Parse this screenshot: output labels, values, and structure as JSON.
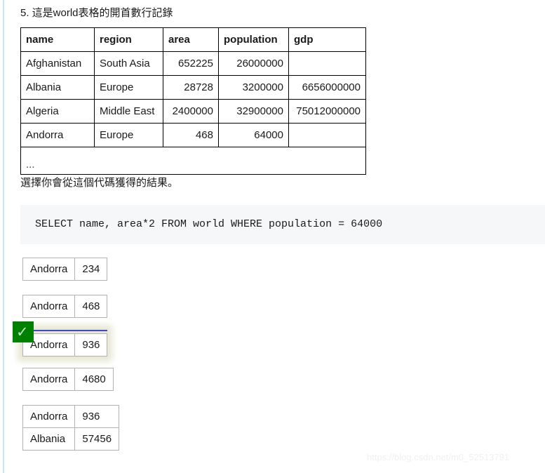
{
  "page": {
    "question_heading": "5. 這是world表格的開首數行記錄",
    "prompt": "選擇你會從這個代碼獲得的結果。",
    "watermark": "https://blog.csdn.net/m0_52513791",
    "accent_selected_border": "#3b4cca",
    "accent_correct_green": "#008000",
    "code_background": "#f6f7f9"
  },
  "world_table": {
    "columns": [
      "name",
      "region",
      "area",
      "population",
      "gdp"
    ],
    "rows": [
      {
        "name": "Afghanistan",
        "region": "South Asia",
        "area": "652225",
        "population": "26000000",
        "gdp": ""
      },
      {
        "name": "Albania",
        "region": "Europe",
        "area": "28728",
        "population": "3200000",
        "gdp": "6656000000"
      },
      {
        "name": "Algeria",
        "region": "Middle East",
        "area": "2400000",
        "population": "32900000",
        "gdp": "75012000000"
      },
      {
        "name": "Andorra",
        "region": "Europe",
        "area": "468",
        "population": "64000",
        "gdp": ""
      }
    ],
    "ellipsis": "..."
  },
  "sql": {
    "code": "SELECT name, area*2 FROM world WHERE population = 64000"
  },
  "options": [
    {
      "id": "option-1",
      "selected": false,
      "rows": [
        {
          "name": "Andorra",
          "value": "234"
        }
      ]
    },
    {
      "id": "option-2",
      "selected": false,
      "rows": [
        {
          "name": "Andorra",
          "value": "468"
        }
      ]
    },
    {
      "id": "option-3",
      "selected": true,
      "badge": "✓",
      "rows": [
        {
          "name": "Andorra",
          "value": "936"
        }
      ]
    },
    {
      "id": "option-4",
      "selected": false,
      "rows": [
        {
          "name": "Andorra",
          "value": "4680"
        }
      ]
    },
    {
      "id": "option-5",
      "selected": false,
      "rows": [
        {
          "name": "Andorra",
          "value": "936"
        },
        {
          "name": "Albania",
          "value": "57456"
        }
      ]
    }
  ]
}
